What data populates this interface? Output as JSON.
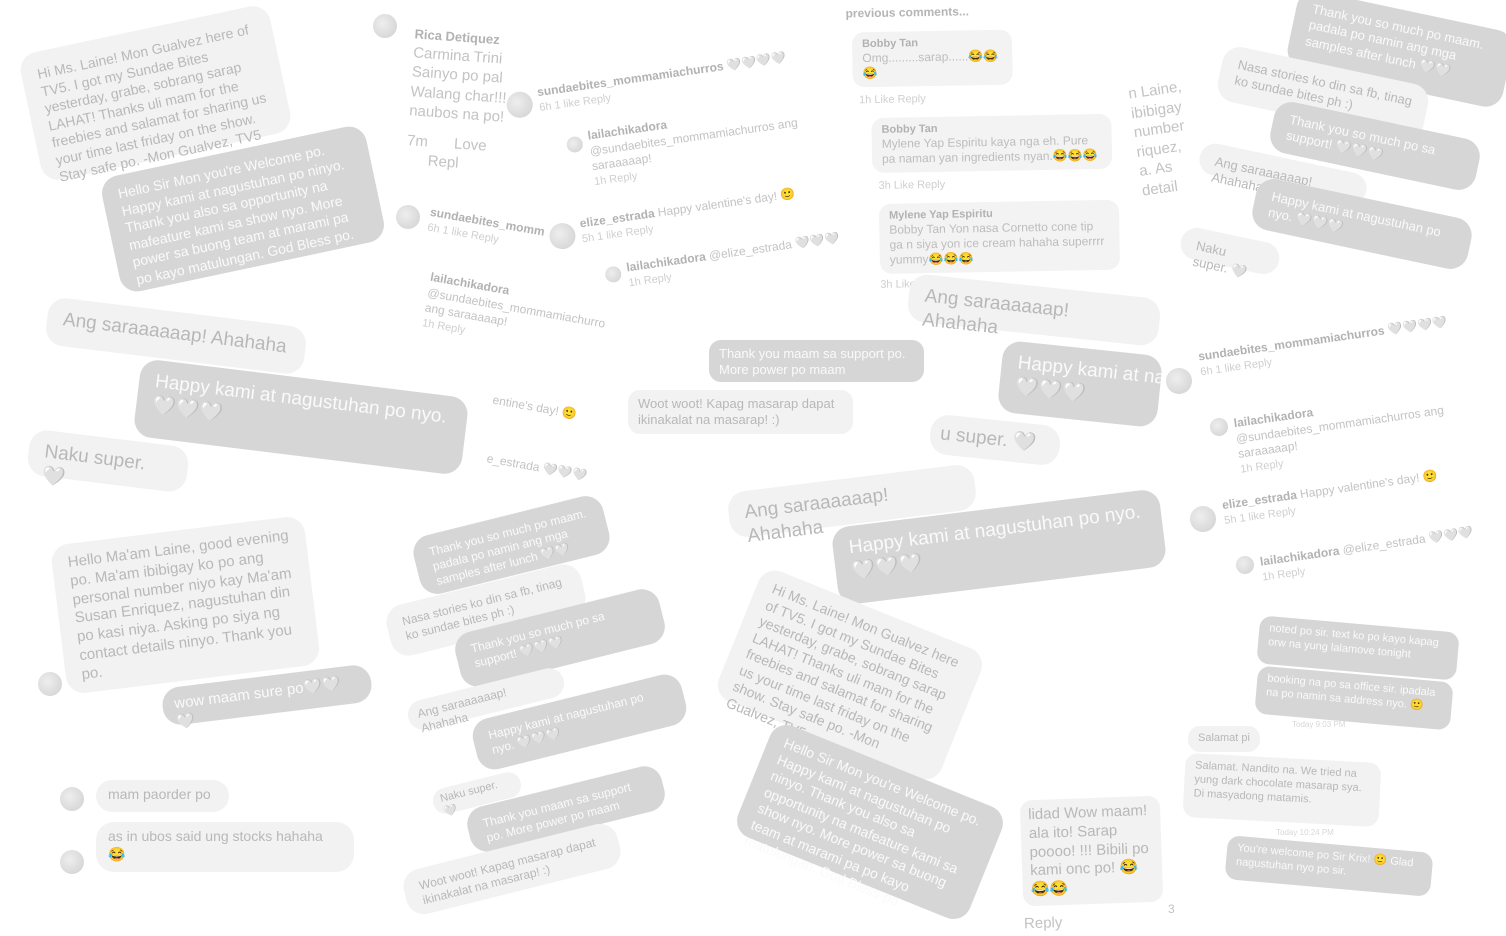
{
  "messages": {
    "mon_intro": "Hi Ms. Laine! Mon Gualvez here of TV5. I got my Sundae Bites yesterday, grabe, sobrang sarap LAHAT! Thanks uli mam for the freebies and salamat for sharing us your time last friday on the show. Stay safe po. -Mon Gualvez, TV5",
    "hello_sir_mon": "Hello Sir Mon you're Welcome po. Happy kami at nagustuhan po ninyo. Thank you also sa opportunity na mafeature kami sa show nyo. More power sa buong team at marami pa po kayo matulungan. God Bless po.",
    "ang_sarap": "Ang saraaaaaap! Ahahaha",
    "happy_kami": "Happy kami at nagustuhan po nyo.",
    "happy_hearts": "🤍🤍🤍",
    "naku_super": "Naku super. 🤍",
    "hello_maam_laine": "Hello Ma'am Laine, good evening po. Ma'am ibibigay ko po ang personal number niyo kay Ma'am Susan Enriquez, nagustuhan din po kasi niya. Asking po siya ng contact details ninyo. Thank you po.",
    "wow_maam": "wow maam sure po🤍🤍🤍",
    "mam_paorder": "mam paorder po",
    "as_in_ubos": "as in ubos said ung stocks hahaha 😂",
    "thank_you_support": "Thank you maam sa support po. More power po maam",
    "woot_woot": "Woot woot! Kapag masarap dapat ikinakalat na masarap! :)",
    "thank_you_so_much": "Thank you so much po maam. padala po namin ang mga samples after lunch 🤍🤍",
    "nasa_stories": "Nasa stories ko din sa fb, tinag ko sundae bites ph :)",
    "thank_you_support_2": "Thank you so much po sa support! 🤍🤍🤍",
    "noted_po_sir": "noted po sir. text ko po kayo kapag orw na yung lalamove tonight",
    "booking_na_po": "booking na po sa office sir. ipadala na po namin sa address nyo. 🙂",
    "today_903": "Today 9:03 PM",
    "salamat_pi": "Salamat pi",
    "salamat_nandito": "Salamat. Nandito na. We tried na yung dark chocolate masarap sya. Di masyadong matamis.",
    "today_1024": "Today 10:24 PM",
    "youre_welcome_krix": "You're welcome po Sir Krix! 🙂 Glad nagustuhan nyo po sir.",
    "wow_maam_sarap": "Wow maam! ala ito! Sarap poooo! !!! Bibili po kami onc po! 😂😂😂",
    "wow_prefix": "lidad",
    "reply": "Reply",
    "count_3": "3"
  },
  "comments": {
    "previous": "previous comments...",
    "rica_name": "Rica Detiquez",
    "rica_line1": "Carmina Trini",
    "rica_line2": "Sainyo po pal",
    "rica_line3": "Walang char!!!",
    "rica_line4": "naubos na po!",
    "rica_meta": "7m",
    "love": "Love",
    "repl": "Repl",
    "sb_user": "sundaebites_mommamiachurros",
    "sb_hearts": "🤍🤍🤍🤍",
    "sb_meta": "6h   1 like   Reply",
    "laila_user": "lailachikadora",
    "laila_text": "@sundaebites_mommamiachurros ang saraaaaap!",
    "laila_meta": "1h   Reply",
    "elize_user": "elize_estrada",
    "elize_text": "Happy valentine's day! 🙂",
    "elize_meta": "5h   1 like   Reply",
    "laila2_text": "@elize_estrada 🤍🤍🤍",
    "laila2_meta": "1h   Reply",
    "bobby_name": "Bobby Tan",
    "bobby_text": "Omg.........sarap......😂😂😂",
    "bobby_meta": "1h   Like   Reply",
    "bobby2_text": "Mylene Yap Espiritu kaya nga eh. Pure pa naman yan ingredients nyan.😂😂😂",
    "bobby2_meta": "3h   Like   Reply",
    "mylene_name": "Mylene Yap Espiritu",
    "mylene_text": "Bobby Tan Yon nasa Cornetto cone tip ga n siya yon ice cream hahaha superrrr yummy😂😂😂",
    "mylene_meta": "3h   Like   Reply",
    "ibibigay_frag": "n Laine, ibibigay number riquez, a. As detail",
    "u_super": "u super. 🤍",
    "sb_short": "sundaebites_momm",
    "ent_day": "entine's day! 🙂",
    "e_estrada": "e_estrada 🤍🤍🤍",
    "one_like": "1 🙂"
  }
}
